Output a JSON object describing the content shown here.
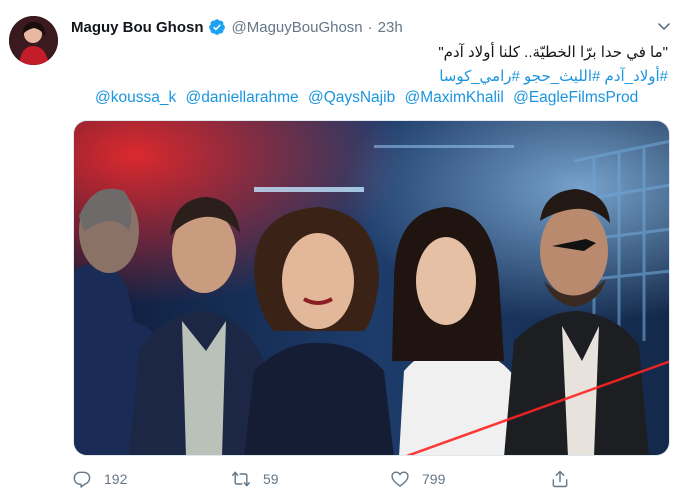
{
  "tweet": {
    "author_name": "Maguy Bou Ghosn",
    "handle": "@MaguyBouGhosn",
    "separator": "·",
    "time": "23h",
    "text_line1": "\"ما في حدا برّا الخطيّة.. كلنا أولاد آدم\"",
    "hashtags": "#أولاد_آدم #الليث_حجو #رامي_كوسا",
    "mentions": [
      "@koussa_k",
      "@daniellarahme",
      "@QaysNajib",
      "@MaximKhalil",
      "@EagleFilmsProd"
    ]
  },
  "actions": {
    "reply_count": "192",
    "retweet_count": "59",
    "like_count": "799"
  },
  "colors": {
    "link": "#1b95e0",
    "verified": "#1da1f2",
    "muted": "#657786"
  },
  "icons": [
    "verified-badge-icon",
    "chevron-down-icon",
    "reply-icon",
    "retweet-icon",
    "like-icon",
    "share-icon"
  ]
}
